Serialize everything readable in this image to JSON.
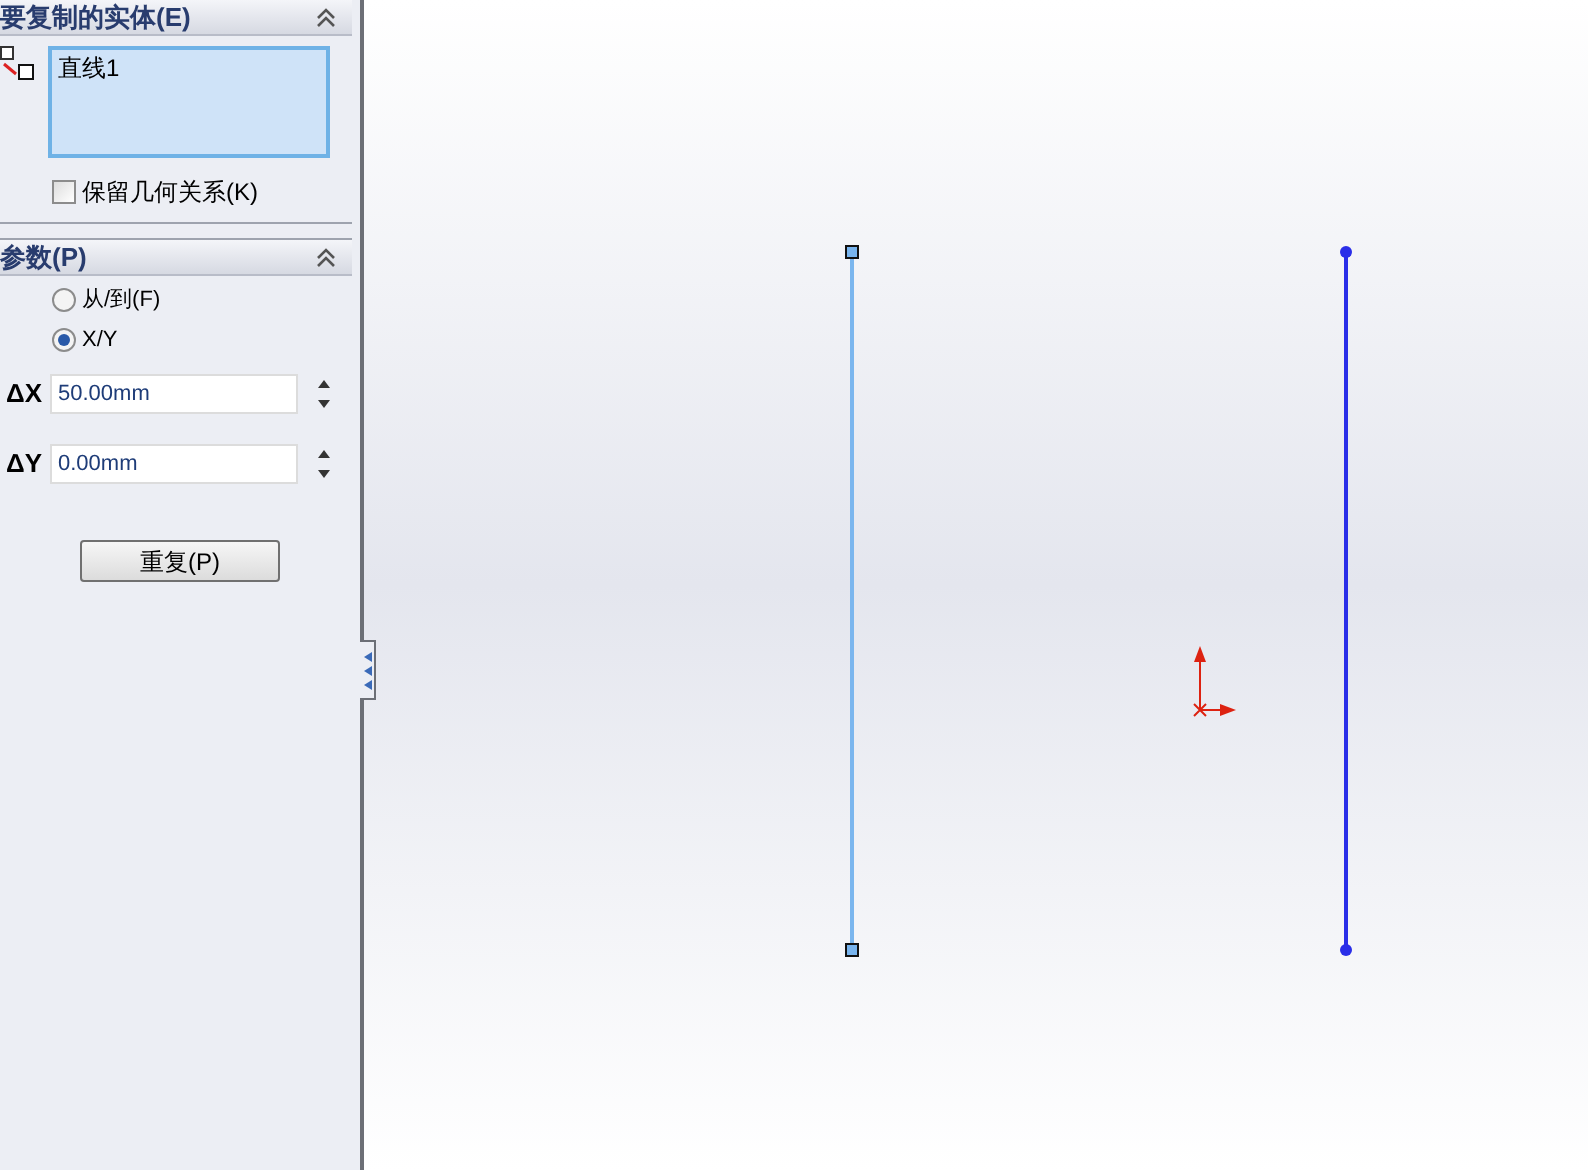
{
  "entities_section": {
    "title": "要复制的实体(E)",
    "items": [
      "直线1"
    ],
    "keep_relations": {
      "label": "保留几何关系(K)",
      "checked": false
    }
  },
  "params_section": {
    "title": "参数(P)",
    "options": [
      {
        "label": "从/到(F)",
        "selected": false
      },
      {
        "label": "X/Y",
        "selected": true
      }
    ],
    "fields": [
      {
        "label": "ΔX",
        "value": "50.00mm"
      },
      {
        "label": "ΔY",
        "value": "0.00mm"
      }
    ]
  },
  "repeat_button": "重复(P)"
}
